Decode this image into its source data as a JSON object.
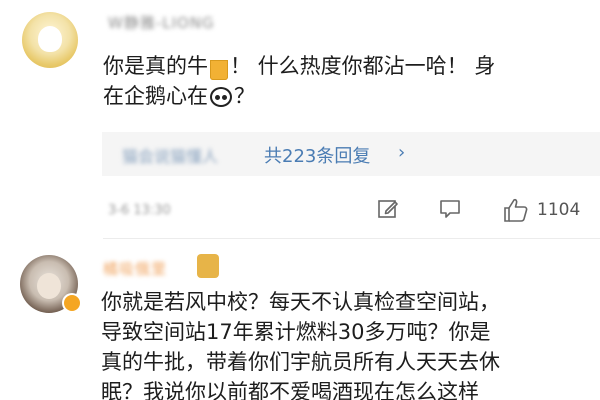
{
  "comments": [
    {
      "username": "W静雅-LIONG",
      "text_lines": [
        "你是真的牛",
        "！ 什么热度你都沾一哈！ 身",
        "在企鹅心在",
        "？"
      ],
      "emoji_beer": "beer-emoji",
      "emoji_panda": "panda-emoji",
      "reply_preview": "猫会说猫懂人",
      "reply_count_label": "共223条回复",
      "reply_chevron": "›",
      "timestamp": "3-6 13:30",
      "like_count": "1104"
    },
    {
      "username": "橘吸俄里",
      "text_lines": [
        "你就是若风中校？每天不认真检查空间站，",
        "导致空间站17年累计燃料30多万吨？你是",
        "真的牛批，带着你们宇航员所有人天天去休",
        "眠？我说你以前都不爱喝酒现在怎么这样"
      ]
    }
  ],
  "icons": {
    "edit": "edit-icon",
    "comment": "comment-icon",
    "like": "thumbs-up-icon"
  },
  "colors": {
    "link": "#4a7cb3",
    "reply_bg": "#f5f5f5",
    "vip_badge": "#f5a623"
  }
}
